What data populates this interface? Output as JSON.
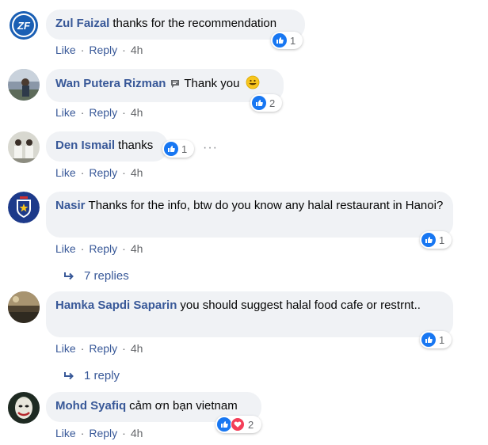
{
  "actions": {
    "like": "Like",
    "reply": "Reply",
    "sep": "·"
  },
  "comments": [
    {
      "author": "Zul Faizal",
      "text": "thanks for the recommendation",
      "time": "4h",
      "reactions": "1",
      "avatar": "zf-logo-avatar"
    },
    {
      "author": "Wan Putera Rizman",
      "text": "Thank you",
      "time": "4h",
      "reactions": "2",
      "avatar": "outdoor-photo-avatar"
    },
    {
      "author": "Den Ismail",
      "text": "thanks",
      "time": "4h",
      "reactions": "1",
      "avatar": "group-photo-avatar"
    },
    {
      "author": "Nasir",
      "text": "Thanks for the info, btw do you know any halal restaurant in Hanoi?",
      "time": "4h",
      "reactions": "1",
      "replies": "7 replies",
      "avatar": "crest-avatar"
    },
    {
      "author": "Hamka Sapdi Saparin",
      "text": "you should suggest halal food cafe or restrnt..",
      "time": "4h",
      "reactions": "1",
      "replies": "1 reply",
      "avatar": "landscape-avatar"
    },
    {
      "author": "Mohd Syafiq",
      "text": "cảm ơn bạn vietnam",
      "time": "4h",
      "reactions": "2",
      "avatar": "joker-avatar"
    }
  ],
  "colors": {
    "author": "#385898",
    "bubble": "#f0f2f5",
    "like": "#1877f2",
    "love": "#f33e58"
  }
}
